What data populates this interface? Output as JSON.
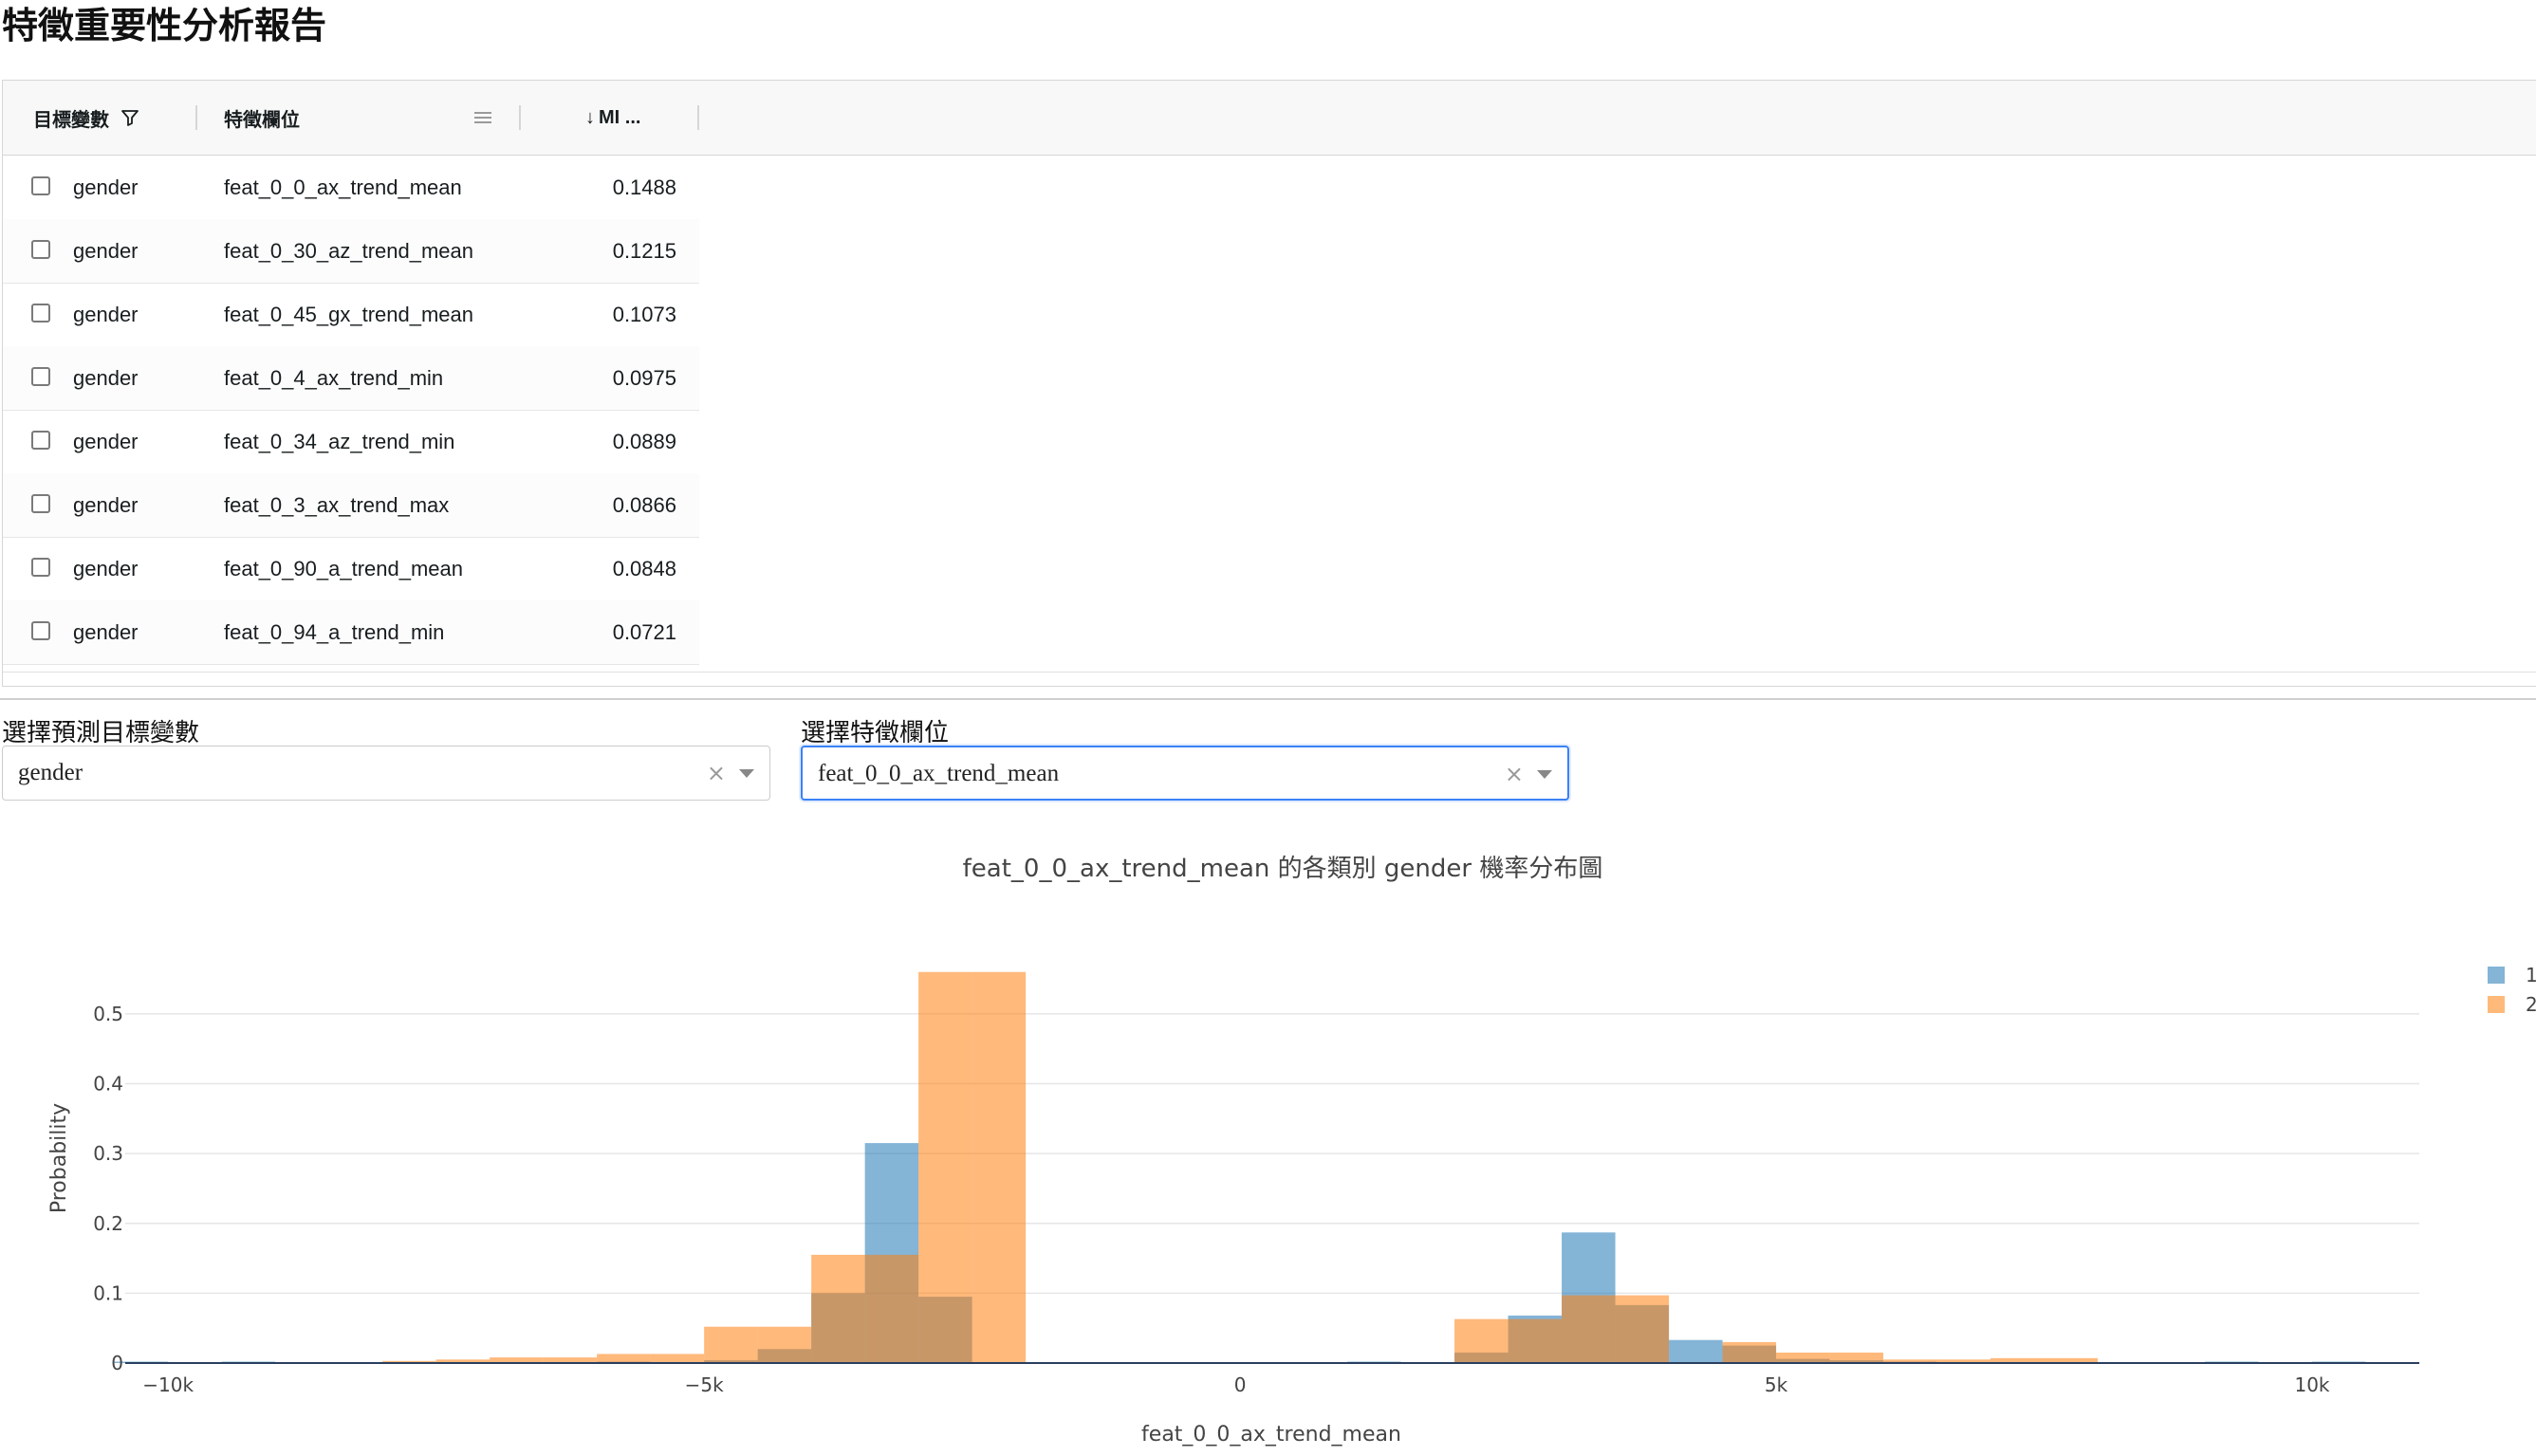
{
  "page_title": "特徵重要性分析報告",
  "grid": {
    "columns": [
      {
        "label": "目標變數",
        "icon": "filter-icon"
      },
      {
        "label": "特徵欄位",
        "icon": "menu-icon"
      },
      {
        "label": "MI ...",
        "sort_indicator": "↓"
      }
    ],
    "rows": [
      {
        "target": "gender",
        "feature": "feat_0_0_ax_trend_mean",
        "mi": "0.1488"
      },
      {
        "target": "gender",
        "feature": "feat_0_30_az_trend_mean",
        "mi": "0.1215"
      },
      {
        "target": "gender",
        "feature": "feat_0_45_gx_trend_mean",
        "mi": "0.1073"
      },
      {
        "target": "gender",
        "feature": "feat_0_4_ax_trend_min",
        "mi": "0.0975"
      },
      {
        "target": "gender",
        "feature": "feat_0_34_az_trend_min",
        "mi": "0.0889"
      },
      {
        "target": "gender",
        "feature": "feat_0_3_ax_trend_max",
        "mi": "0.0866"
      },
      {
        "target": "gender",
        "feature": "feat_0_90_a_trend_mean",
        "mi": "0.0848"
      },
      {
        "target": "gender",
        "feature": "feat_0_94_a_trend_min",
        "mi": "0.0721"
      }
    ]
  },
  "target_select": {
    "label": "選擇預測目標變數",
    "value": "gender",
    "clear": "×"
  },
  "feature_select": {
    "label": "選擇特徵欄位",
    "value": "feat_0_0_ax_trend_mean",
    "clear": "×"
  },
  "chart_data": {
    "type": "bar",
    "title": "feat_0_0_ax_trend_mean 的各類別 gender 機率分布圖",
    "xlabel": "feat_0_0_ax_trend_mean",
    "ylabel": "Probability",
    "xlim": [
      -10400,
      11000
    ],
    "ylim": [
      0,
      0.58
    ],
    "x_ticks": [
      -10000,
      -5000,
      0,
      5000,
      10000
    ],
    "x_tick_labels": [
      "−10k",
      "−5k",
      "0",
      "5k",
      "10k"
    ],
    "y_ticks": [
      0,
      0.1,
      0.2,
      0.3,
      0.4,
      0.5
    ],
    "y_tick_labels": [
      "0",
      "0.1",
      "0.2",
      "0.3",
      "0.4",
      "0.5"
    ],
    "grid": true,
    "legend_position": "top-right",
    "bin_width": 500,
    "series": [
      {
        "name": "1",
        "color": "#1f77b4",
        "bins": [
          [
            -10500,
            0.001
          ],
          [
            -9500,
            0.001
          ],
          [
            -6000,
            0.002
          ],
          [
            -5000,
            0.004
          ],
          [
            -4500,
            0.02
          ],
          [
            -4000,
            0.1
          ],
          [
            -3500,
            0.315
          ],
          [
            -3000,
            0.095
          ],
          [
            1000,
            0.002
          ],
          [
            2000,
            0.015
          ],
          [
            2500,
            0.068
          ],
          [
            3000,
            0.187
          ],
          [
            3500,
            0.083
          ],
          [
            4000,
            0.033
          ],
          [
            4500,
            0.025
          ],
          [
            5000,
            0.006
          ],
          [
            5500,
            0.004
          ],
          [
            6000,
            0.002
          ],
          [
            9000,
            0.001
          ],
          [
            10000,
            0.001
          ]
        ]
      },
      {
        "name": "2",
        "color": "#ff7f0e",
        "bins": [
          [
            -8000,
            0.003
          ],
          [
            -7500,
            0.005
          ],
          [
            -7000,
            0.008
          ],
          [
            -6500,
            0.008
          ],
          [
            -6000,
            0.013
          ],
          [
            -5500,
            0.013
          ],
          [
            -5000,
            0.052
          ],
          [
            -4500,
            0.052
          ],
          [
            -4000,
            0.155
          ],
          [
            -3500,
            0.155
          ],
          [
            -3000,
            0.56
          ],
          [
            -2500,
            0.56
          ],
          [
            2000,
            0.063
          ],
          [
            2500,
            0.063
          ],
          [
            3000,
            0.097
          ],
          [
            3500,
            0.097
          ],
          [
            4500,
            0.03
          ],
          [
            5000,
            0.015
          ],
          [
            5500,
            0.015
          ],
          [
            6000,
            0.005
          ],
          [
            6500,
            0.005
          ],
          [
            7000,
            0.007
          ],
          [
            7500,
            0.007
          ]
        ]
      }
    ]
  }
}
